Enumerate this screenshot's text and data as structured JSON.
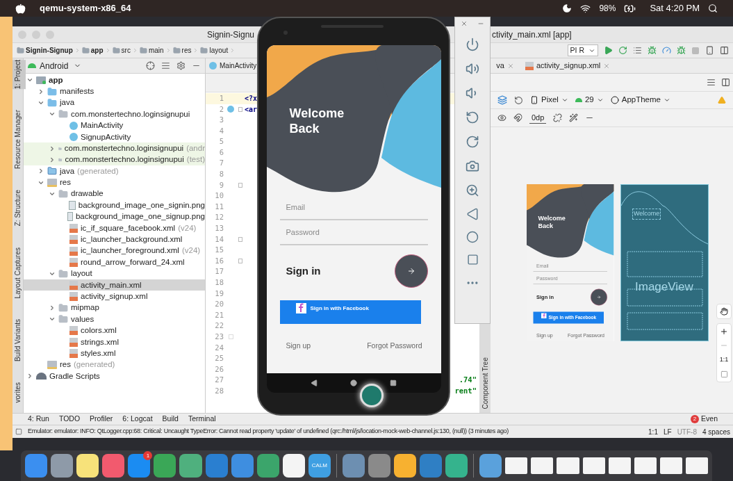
{
  "menu_bar": {
    "app": "qemu-system-x86_64",
    "battery": "98%",
    "clock": "Sat 4:20 PM"
  },
  "ide": {
    "title_parts": [
      "Signin-Signu",
      "ctivity_main.xml [app]"
    ],
    "breadcrumbs": [
      "Signin-Signup",
      "app",
      "src",
      "main",
      "res",
      "layout"
    ],
    "run_config": "PI R",
    "side_tabs": [
      {
        "label": "1: Project",
        "selected": true
      },
      {
        "label": "Resource Manager",
        "selected": false
      },
      {
        "label": "Z: Structure",
        "selected": false
      },
      {
        "label": "Layout Captures",
        "selected": false
      },
      {
        "label": "Build Variants",
        "selected": false
      },
      {
        "label": "vorites",
        "selected": false
      }
    ],
    "project_view": "Android",
    "tree": [
      {
        "name": "app",
        "kind": "module",
        "expanded": true,
        "selected": false,
        "children": [
          {
            "name": "manifests",
            "kind": "folder",
            "expanded": false,
            "selected": false
          },
          {
            "name": "java",
            "kind": "folder",
            "expanded": true,
            "selected": false,
            "children": [
              {
                "name": "com.monstertechno.loginsignupui",
                "kind": "package",
                "expanded": true,
                "selected": false,
                "children": [
                  {
                    "name": "MainActivity",
                    "kind": "class",
                    "selected": false
                  },
                  {
                    "name": "SignupActivity",
                    "kind": "class",
                    "selected": false
                  }
                ]
              },
              {
                "name": "com.monstertechno.loginsignupui",
                "suffix": "(andr",
                "kind": "test-package",
                "expanded": false,
                "selected": false
              },
              {
                "name": "com.monstertechno.loginsignupui",
                "suffix": "(test)",
                "kind": "test-package",
                "expanded": false,
                "selected": false
              }
            ]
          },
          {
            "name": "java",
            "suffix": "(generated)",
            "kind": "generated-folder",
            "expanded": false,
            "selected": false
          },
          {
            "name": "res",
            "kind": "res-folder",
            "expanded": true,
            "selected": false,
            "children": [
              {
                "name": "drawable",
                "kind": "package",
                "expanded": true,
                "selected": false,
                "children": [
                  {
                    "name": "background_image_one_signin.png",
                    "kind": "image",
                    "selected": false
                  },
                  {
                    "name": "background_image_one_signup.png",
                    "kind": "image",
                    "selected": false
                  },
                  {
                    "name": "ic_if_square_facebook.xml",
                    "suffix": "(v24)",
                    "kind": "xml",
                    "selected": false
                  },
                  {
                    "name": "ic_launcher_background.xml",
                    "kind": "xml",
                    "selected": false
                  },
                  {
                    "name": "ic_launcher_foreground.xml",
                    "suffix": "(v24)",
                    "kind": "xml",
                    "selected": false
                  },
                  {
                    "name": "round_arrow_forward_24.xml",
                    "kind": "xml",
                    "selected": false
                  }
                ]
              },
              {
                "name": "layout",
                "kind": "package",
                "expanded": true,
                "selected": false,
                "children": [
                  {
                    "name": "activity_main.xml",
                    "kind": "xml",
                    "selected": true
                  },
                  {
                    "name": "activity_signup.xml",
                    "kind": "xml",
                    "selected": false
                  }
                ]
              },
              {
                "name": "mipmap",
                "kind": "package",
                "expanded": false,
                "selected": false
              },
              {
                "name": "values",
                "kind": "package",
                "expanded": true,
                "selected": false,
                "children": [
                  {
                    "name": "colors.xml",
                    "kind": "xml",
                    "selected": false
                  },
                  {
                    "name": "strings.xml",
                    "kind": "xml",
                    "selected": false
                  },
                  {
                    "name": "styles.xml",
                    "kind": "xml",
                    "selected": false
                  }
                ]
              }
            ]
          },
          {
            "name": "res",
            "suffix": "(generated)",
            "kind": "res-generated",
            "selected": false
          }
        ]
      },
      {
        "name": "Gradle Scripts",
        "kind": "gradle",
        "expanded": false,
        "selected": false
      }
    ],
    "editor_tabs": [
      {
        "label": "MainActivity",
        "kind": "class",
        "closable": false,
        "selected": false
      },
      {
        "label": "va",
        "kind": "plain",
        "closable": true,
        "selected": false
      },
      {
        "label": "activity_signup.xml",
        "kind": "xml",
        "closable": true,
        "selected": false
      }
    ],
    "lines": [
      {
        "number": "1",
        "kind": "plain",
        "code": "<?x",
        "current": true,
        "fold": false
      },
      {
        "number": "2",
        "kind": "class",
        "code": "<ar",
        "current": false,
        "fold": true
      },
      {
        "number": "3",
        "kind": "plain",
        "current": false,
        "fold": false
      },
      {
        "number": "4",
        "kind": "plain",
        "current": false,
        "fold": false
      },
      {
        "number": "5",
        "kind": "plain",
        "current": false,
        "fold": false
      },
      {
        "number": "6",
        "kind": "plain",
        "current": false,
        "fold": false
      },
      {
        "number": "7",
        "kind": "plain",
        "current": false,
        "fold": false
      },
      {
        "number": "8",
        "kind": "plain",
        "current": false,
        "fold": false
      },
      {
        "number": "9",
        "kind": "plain",
        "current": false,
        "fold": true
      },
      {
        "number": "10",
        "kind": "plain",
        "current": false,
        "fold": false
      },
      {
        "number": "11",
        "kind": "plain",
        "current": false,
        "fold": false
      },
      {
        "number": "12",
        "kind": "plain",
        "current": false,
        "fold": false
      },
      {
        "number": "13",
        "kind": "plain",
        "current": false,
        "fold": false
      },
      {
        "number": "14",
        "kind": "plain",
        "current": false,
        "fold": true
      },
      {
        "number": "15",
        "kind": "plain",
        "current": false,
        "fold": false
      },
      {
        "number": "16",
        "kind": "plain",
        "current": false,
        "fold": true
      },
      {
        "number": "17",
        "kind": "plain",
        "current": false,
        "fold": false
      },
      {
        "number": "18",
        "kind": "plain",
        "current": false,
        "fold": false
      },
      {
        "number": "19",
        "kind": "plain",
        "current": false,
        "fold": false
      },
      {
        "number": "20",
        "kind": "plain",
        "current": false,
        "fold": false
      },
      {
        "number": "21",
        "kind": "plain",
        "current": false,
        "fold": false
      },
      {
        "number": "22",
        "kind": "plain",
        "current": false,
        "fold": false
      },
      {
        "number": "23",
        "kind": "swatch",
        "current": false,
        "fold": false
      },
      {
        "number": "24",
        "kind": "plain",
        "current": false,
        "fold": false
      },
      {
        "number": "25",
        "kind": "plain",
        "current": false,
        "fold": false
      },
      {
        "number": "26",
        "kind": "plain",
        "current": false,
        "fold": false
      },
      {
        "number": "27",
        "kind": "plain",
        "right": ".74\"",
        "current": false,
        "fold": false
      },
      {
        "number": "28",
        "kind": "plain",
        "right": "rent\"",
        "current": false,
        "fold": false
      }
    ],
    "designer": {
      "device": "Pixel",
      "api": "29",
      "theme": "AppTheme",
      "margin": "0dp",
      "zoom_reset": "1:1",
      "component_tree": "Component Tree",
      "preview": {
        "title": "Welcome Back",
        "email": "Email",
        "password": "Password",
        "sign_in": "Sign in",
        "facebook": "Sign in with Facebook",
        "sign_up": "Sign up",
        "forgot": "Forgot Password"
      },
      "blueprint_labels": [
        "Welcome",
        "ImageView"
      ]
    },
    "bottom_tabs": [
      "4: Run",
      "TODO",
      "Profiler",
      "6: Logcat",
      "Build",
      "Terminal"
    ],
    "event_log": {
      "count": "2",
      "label": "Even"
    },
    "status": {
      "message": "Emulator: emulator: INFO: QtLogger.cpp:68: Critical: Uncaught TypeError: Cannot read property 'update' of undefined (qrc:/html/js/location-mock-web-channel.js:130, (null)) (3 minutes ago)",
      "position": "1:1",
      "line_separator": "LF",
      "encoding": "UTF-8",
      "indent": "4 spaces"
    }
  },
  "emulator": {
    "screen": {
      "title": "Welcome Back",
      "email": "Email",
      "password": "Password",
      "sign_in": "Sign in",
      "facebook": "Sign in with Facebook",
      "sign_up": "Sign up",
      "forgot": "Forgot Password"
    }
  },
  "dock": {
    "apps": [
      {
        "kind": "finder",
        "color": "#3b8ff0"
      },
      {
        "kind": "launchpad",
        "color": "#8e9aa8"
      },
      {
        "kind": "notes",
        "color": "#f7e27a"
      },
      {
        "kind": "music",
        "color": "#f25a6e"
      },
      {
        "kind": "appstore",
        "color": "#1b8cf2",
        "badge": "1"
      },
      {
        "kind": "chrome",
        "color": "#3aa757"
      },
      {
        "kind": "atom",
        "color": "#4fb07e"
      },
      {
        "kind": "vscode",
        "color": "#2a7fd0"
      },
      {
        "kind": "xcode",
        "color": "#3e8ee0"
      },
      {
        "kind": "android",
        "color": "#3ba56b"
      },
      {
        "kind": "slack",
        "color": "#f4f4f4"
      },
      {
        "kind": "calm",
        "color": "#3f9fe2",
        "label": "CALM"
      },
      {
        "kind": "separator",
        "color": "#777777"
      },
      {
        "kind": "preview",
        "color": "#6d8fb1"
      },
      {
        "kind": "settings",
        "color": "#8a8a8a"
      },
      {
        "kind": "sketch",
        "color": "#f7b130"
      },
      {
        "kind": "brackets",
        "color": "#2f7fc4"
      },
      {
        "kind": "editor",
        "color": "#35b38d"
      },
      {
        "kind": "separator",
        "color": "#777777"
      },
      {
        "kind": "folder",
        "color": "#5aa1dc"
      }
    ]
  }
}
